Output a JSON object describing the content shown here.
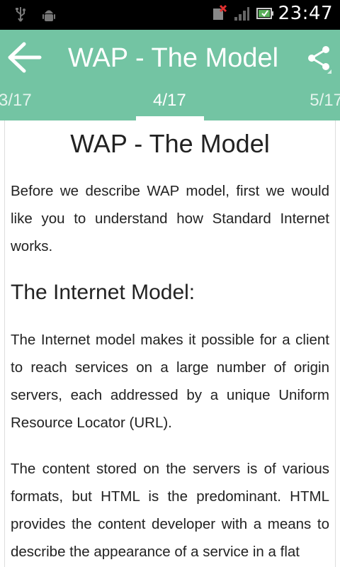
{
  "status_bar": {
    "time": "23:47",
    "icons": [
      "usb-icon",
      "android-debug-icon",
      "no-sim-icon",
      "signal-icon",
      "battery-icon"
    ]
  },
  "app_bar": {
    "title": "WAP - The Model",
    "back_icon": "back-arrow-icon",
    "share_icon": "share-icon",
    "color": "#73c4a3"
  },
  "pager": {
    "prev": "3/17",
    "current": "4/17",
    "next": "5/17"
  },
  "article": {
    "title": "WAP - The Model",
    "intro": "Before we describe WAP model, first we would like you to understand how Standard Internet works.",
    "section_heading": "The Internet Model:",
    "paragraph_1": "The Internet model makes it possible for a client to reach services on a large number of origin servers, each addressed by a unique Uniform Resource Locator (URL).",
    "paragraph_2": "The content stored on the servers is of various formats, but HTML is the predominant. HTML provides the content developer with a means to describe the appearance of a service in a flat"
  }
}
